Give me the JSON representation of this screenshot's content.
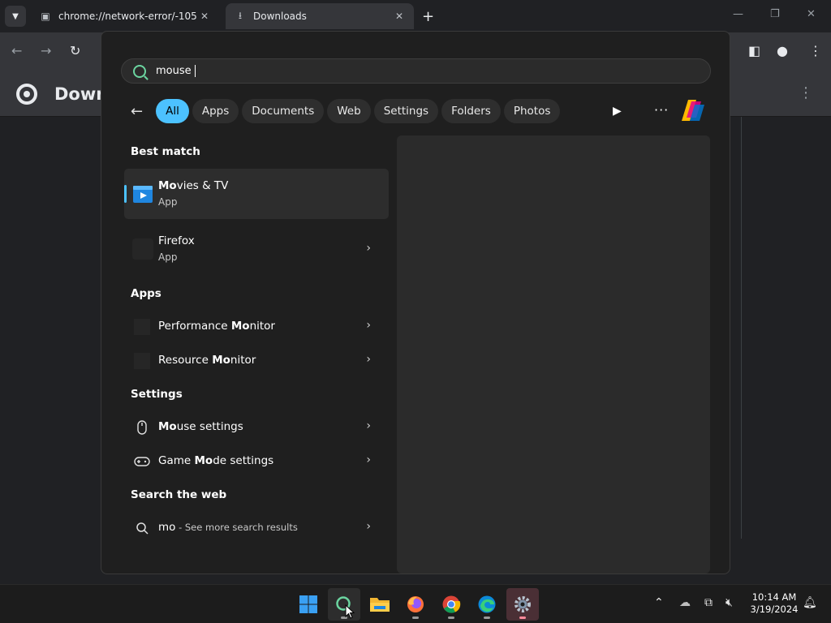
{
  "browser": {
    "tabs": [
      {
        "title": "chrome://network-error/-105",
        "icon": "page-icon"
      },
      {
        "title": "Downloads",
        "icon": "download-icon"
      }
    ],
    "page_title": "Downloads"
  },
  "search": {
    "query": "mouse",
    "filters": [
      {
        "label": "All",
        "active": true
      },
      {
        "label": "Apps",
        "active": false
      },
      {
        "label": "Documents",
        "active": false
      },
      {
        "label": "Web",
        "active": false
      },
      {
        "label": "Settings",
        "active": false
      },
      {
        "label": "Folders",
        "active": false
      },
      {
        "label": "Photos",
        "active": false
      }
    ],
    "best_match_label": "Best match",
    "best_matches": [
      {
        "title_bold": "Mo",
        "title_rest": "vies & TV",
        "subtitle": "App"
      },
      {
        "title": "Firefox",
        "subtitle": "App"
      }
    ],
    "apps_label": "Apps",
    "apps": [
      {
        "title_pre": "Performance ",
        "title_bold": "Mo",
        "title_rest": "nitor"
      },
      {
        "title_pre": "Resource ",
        "title_bold": "Mo",
        "title_rest": "nitor"
      }
    ],
    "settings_label": "Settings",
    "settings": [
      {
        "title_pre": "",
        "title_bold": "Mo",
        "title_rest": "use settings",
        "icon": "mouse-icon"
      },
      {
        "title_pre": "Game ",
        "title_bold": "Mo",
        "title_rest": "de settings",
        "icon": "gamepad-icon"
      }
    ],
    "web_label": "Search the web",
    "web": {
      "query": "mo",
      "suffix": " - See more search results"
    }
  },
  "taskbar": {
    "time": "10:14 AM",
    "date": "3/19/2024"
  },
  "colors": {
    "accent": "#4cc2ff",
    "search_icon": "#6bd5a0"
  }
}
